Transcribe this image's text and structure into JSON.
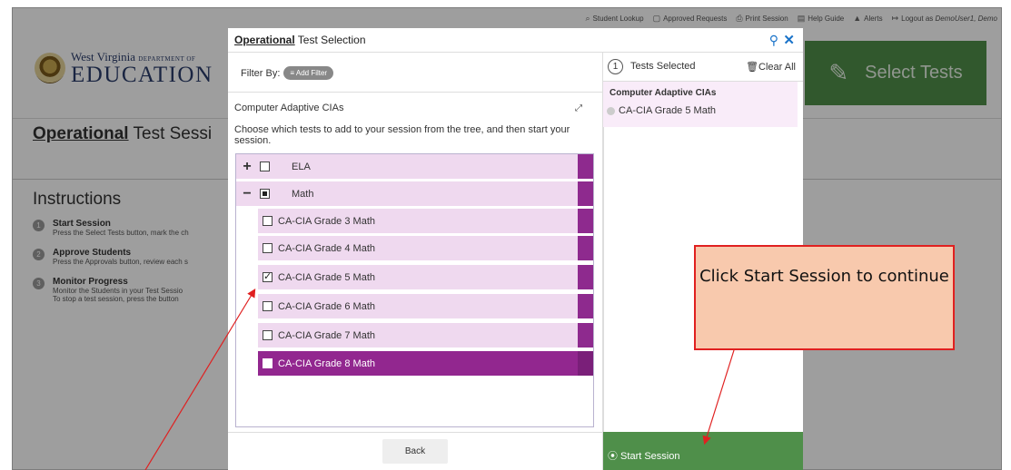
{
  "topbar": {
    "links": [
      {
        "icon": "search-icon",
        "glyph": "⌕",
        "label": "Student Lookup"
      },
      {
        "icon": "document-icon",
        "glyph": "▢",
        "label": "Approved Requests"
      },
      {
        "icon": "printer-icon",
        "glyph": "⎙",
        "label": "Print Session"
      },
      {
        "icon": "book-icon",
        "glyph": "▤",
        "label": "Help Guide"
      },
      {
        "icon": "alert-icon",
        "glyph": "▲",
        "label": "Alerts"
      },
      {
        "icon": "logout-icon",
        "glyph": "↦",
        "label": "Logout as"
      }
    ],
    "user": "DemoUser1, Demo"
  },
  "header": {
    "logo_line1": "West Virginia",
    "logo_line1_small": "DEPARTMENT OF",
    "logo_line2": "EDUCATION",
    "select_tests_label": "Select Tests"
  },
  "session": {
    "title_bold": "Operational",
    "title_rest": " Test Sessi"
  },
  "instructions": {
    "heading": "Instructions",
    "steps": [
      {
        "num": "1",
        "title": "Start Session",
        "desc": "Press the Select Tests button, mark the ch"
      },
      {
        "num": "2",
        "title": "Approve Students",
        "desc": "Press the Approvals button, review each s"
      },
      {
        "num": "3",
        "title": "Monitor Progress",
        "desc": "Monitor the Students in your Test Sessio"
      },
      {
        "num": "",
        "title": "",
        "desc": "To stop a test session, press the   button"
      }
    ]
  },
  "modal": {
    "title_bold": "Operational",
    "title_rest": " Test Selection",
    "filter_label": "Filter By:",
    "filter_button": "≡ Add Filter",
    "group_title": "Computer Adaptive CIAs",
    "instructions": "Choose which tests to add to your session from the tree, and then start your session.",
    "tree": [
      {
        "label": "ELA",
        "expander": "+",
        "state": "unchecked"
      },
      {
        "label": "Math",
        "expander": "−",
        "state": "partial"
      },
      {
        "label": "CA-CIA Grade 3 Math",
        "state": "unchecked"
      },
      {
        "label": "CA-CIA Grade 4 Math",
        "state": "unchecked"
      },
      {
        "label": "CA-CIA Grade 5 Math",
        "state": "checked"
      },
      {
        "label": "CA-CIA Grade 6 Math",
        "state": "unchecked"
      },
      {
        "label": "CA-CIA Grade 7 Math",
        "state": "unchecked"
      },
      {
        "label": "CA-CIA Grade 8 Math",
        "state": "highlighted"
      }
    ],
    "back_button": "Back",
    "selected_count": "1",
    "selected_label": "Tests Selected",
    "clear_all": "🗑Clear All",
    "selected_group": "Computer Adaptive CIAs",
    "selected_item": "CA-CIA Grade 5 Math",
    "start_button": "⦿ Start Session"
  },
  "callout": {
    "text": "Click Start Session to continue"
  },
  "colors": {
    "accent_green": "#4f8f4a",
    "tree_purple": "#92278f",
    "tree_row_bg": "#efd9ef",
    "callout_fill": "#f8c9ad",
    "callout_border": "#e02020"
  }
}
